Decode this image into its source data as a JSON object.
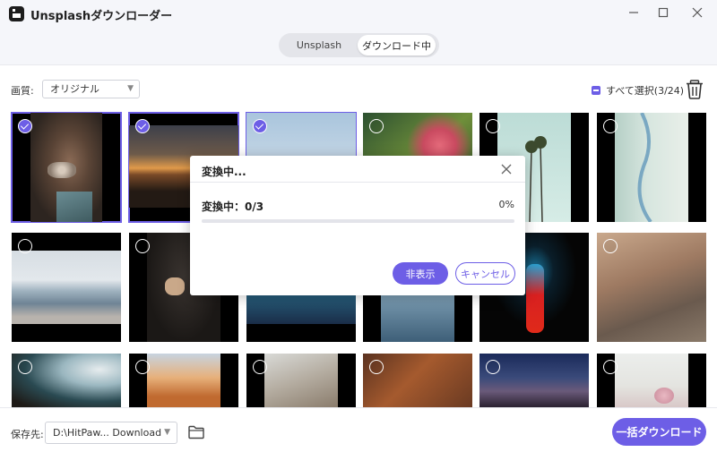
{
  "app": {
    "title": "Unsplashダウンローダー"
  },
  "window_controls": {
    "minimize": "—",
    "maximize": "☐",
    "close": "✕"
  },
  "tabs": [
    {
      "label": "Unsplash",
      "active": false
    },
    {
      "label": "ダウンロード中",
      "active": true
    }
  ],
  "toolbar": {
    "quality_label": "画質:",
    "quality_value": "オリジナル",
    "select_all_label": "すべて選択(3/24)"
  },
  "grid": {
    "tiles": [
      {
        "selected": true,
        "icon": "photo-hands-stones"
      },
      {
        "selected": true,
        "icon": "photo-sunset-mountains"
      },
      {
        "selected": true,
        "icon": "photo-sky-horizon"
      },
      {
        "selected": false,
        "icon": "photo-pink-flower"
      },
      {
        "selected": false,
        "icon": "photo-palm-trees"
      },
      {
        "selected": false,
        "icon": "photo-coast-aerial"
      },
      {
        "selected": false,
        "icon": "photo-sea-shore"
      },
      {
        "selected": false,
        "icon": "photo-man-portrait"
      },
      {
        "selected": false,
        "icon": "photo-city-night"
      },
      {
        "selected": false,
        "icon": "photo-blue-lake"
      },
      {
        "selected": false,
        "icon": "photo-neon-person"
      },
      {
        "selected": false,
        "icon": "photo-hikers-rocks"
      },
      {
        "selected": false,
        "icon": "photo-abstract-shape"
      },
      {
        "selected": false,
        "icon": "photo-desert-peaks"
      },
      {
        "selected": false,
        "icon": "photo-hands-light"
      },
      {
        "selected": false,
        "icon": "photo-brown-texture"
      },
      {
        "selected": false,
        "icon": "photo-starry-night"
      },
      {
        "selected": false,
        "icon": "photo-pink-blossom"
      }
    ]
  },
  "modal": {
    "title": "変換中...",
    "progress_label": "変換中：0/3",
    "progress_percent_text": "0%",
    "progress_fraction": 0,
    "hide_button": "非表示",
    "cancel_button": "キャンセル"
  },
  "bottom": {
    "save_label": "保存先:",
    "save_path": "D:\\HitPaw... Download",
    "download_all_button": "一括ダウンロード"
  },
  "colors": {
    "accent": "#6d5ee6"
  }
}
